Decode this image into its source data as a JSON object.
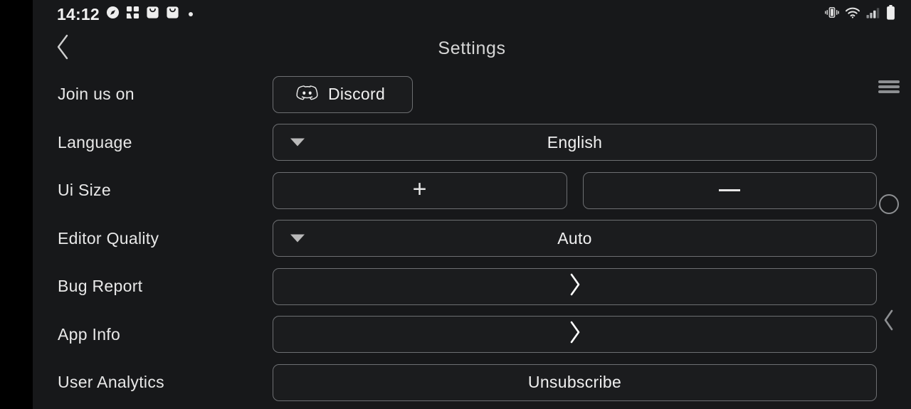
{
  "statusbar": {
    "time": "14:12",
    "left_icons": [
      {
        "name": "compass-icon"
      },
      {
        "name": "puzzle-grid-icon"
      },
      {
        "name": "shopping-bag-icon"
      },
      {
        "name": "shopping-bag-icon-2"
      },
      {
        "name": "dot-indicator-icon"
      }
    ],
    "right_icons": [
      {
        "name": "vibrate-icon"
      },
      {
        "name": "wifi-icon"
      },
      {
        "name": "cellular-signal-icon"
      },
      {
        "name": "battery-icon"
      }
    ]
  },
  "header": {
    "title": "Settings",
    "back_icon": "chevron-left-icon"
  },
  "rows": [
    {
      "label": "Join us on",
      "control": "brand-button",
      "value": "Discord",
      "icon": "discord-logo-icon"
    },
    {
      "label": "Language",
      "control": "dropdown",
      "value": "English",
      "icon": "caret-down-icon"
    },
    {
      "label": "Ui Size",
      "control": "stepper",
      "increase_label": "+",
      "decrease_label": "—",
      "increase_icon": "plus-icon",
      "decrease_icon": "minus-icon"
    },
    {
      "label": "Editor Quality",
      "control": "dropdown",
      "value": "Auto",
      "icon": "caret-down-icon"
    },
    {
      "label": "Bug Report",
      "control": "navigate",
      "value": "",
      "icon": "chevron-right-icon"
    },
    {
      "label": "App Info",
      "control": "navigate",
      "value": "",
      "icon": "chevron-right-icon"
    },
    {
      "label": "User Analytics",
      "control": "action-button",
      "value": "Unsubscribe",
      "icon": ""
    }
  ],
  "edge_controls": [
    {
      "name": "menu-icon"
    },
    {
      "name": "home-circle-icon"
    },
    {
      "name": "back-chevron-icon"
    }
  ],
  "colors": {
    "background": "#17181a",
    "bezel": "#000000",
    "button_border": "#6d6f72",
    "button_fill": "#1b1c1e",
    "text_primary": "#e8e8e8",
    "text_title": "#d6d6d6",
    "icon_muted": "#8d8f92"
  }
}
